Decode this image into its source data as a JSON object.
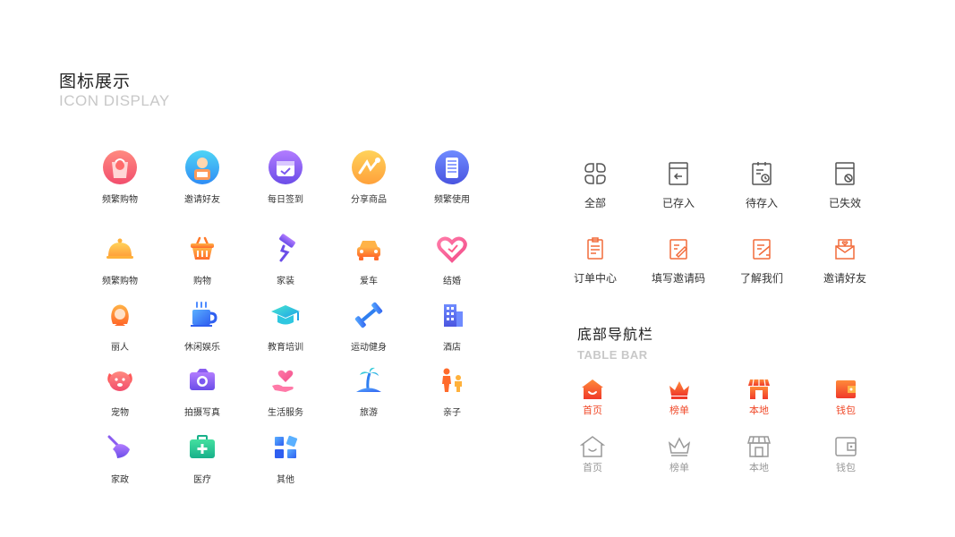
{
  "header": {
    "title_cn": "图标展示",
    "title_en": "ICON DISPLAY"
  },
  "icon_grid": [
    {
      "label": "频繁购物",
      "icon": "shopping-bag-avatar-icon"
    },
    {
      "label": "邀请好友",
      "icon": "invite-friend-avatar-icon"
    },
    {
      "label": "每日签到",
      "icon": "calendar-checkin-icon"
    },
    {
      "label": "分享商品",
      "icon": "share-product-icon"
    },
    {
      "label": "频繁使用",
      "icon": "phone-usage-icon"
    },
    {
      "label": "频繁购物",
      "icon": "food-cloche-icon"
    },
    {
      "label": "购物",
      "icon": "shopping-basket-icon"
    },
    {
      "label": "家装",
      "icon": "paint-roller-icon"
    },
    {
      "label": "爱车",
      "icon": "car-icon"
    },
    {
      "label": "结婚",
      "icon": "heart-icon"
    },
    {
      "label": "丽人",
      "icon": "beauty-woman-icon"
    },
    {
      "label": "休闲娱乐",
      "icon": "coffee-cup-icon"
    },
    {
      "label": "教育培训",
      "icon": "graduation-cap-icon"
    },
    {
      "label": "运动健身",
      "icon": "dumbbell-icon"
    },
    {
      "label": "酒店",
      "icon": "hotel-building-icon"
    },
    {
      "label": "宠物",
      "icon": "dog-face-icon"
    },
    {
      "label": "拍摄写真",
      "icon": "camera-icon"
    },
    {
      "label": "生活服务",
      "icon": "hand-heart-icon"
    },
    {
      "label": "旅游",
      "icon": "palm-beach-icon"
    },
    {
      "label": "亲子",
      "icon": "parent-child-icon"
    },
    {
      "label": "家政",
      "icon": "broom-icon"
    },
    {
      "label": "医疗",
      "icon": "medical-kit-icon"
    },
    {
      "label": "其他",
      "icon": "apps-grid-icon"
    }
  ],
  "order_icons": [
    {
      "label": "全部",
      "icon": "all-clover-icon"
    },
    {
      "label": "已存入",
      "icon": "saved-doc-icon"
    },
    {
      "label": "待存入",
      "icon": "pending-doc-icon"
    },
    {
      "label": "已失效",
      "icon": "expired-doc-icon"
    },
    {
      "label": "订单中心",
      "icon": "order-list-icon"
    },
    {
      "label": "填写邀请码",
      "icon": "fill-code-icon"
    },
    {
      "label": "了解我们",
      "icon": "about-us-icon"
    },
    {
      "label": "邀请好友",
      "icon": "invite-envelope-icon"
    }
  ],
  "tabbar": {
    "title_cn": "底部导航栏",
    "title_en": "TABLE BAR",
    "active": [
      {
        "label": "首页",
        "icon": "home-icon"
      },
      {
        "label": "榜单",
        "icon": "crown-icon"
      },
      {
        "label": "本地",
        "icon": "store-icon"
      },
      {
        "label": "钱包",
        "icon": "wallet-icon"
      }
    ],
    "inactive": [
      {
        "label": "首页",
        "icon": "home-icon"
      },
      {
        "label": "榜单",
        "icon": "crown-icon"
      },
      {
        "label": "本地",
        "icon": "store-icon"
      },
      {
        "label": "钱包",
        "icon": "wallet-icon"
      }
    ]
  },
  "colors": {
    "active_tab": "#f04a2a",
    "inactive_tab": "#999999",
    "title_en": "#c8c8c8",
    "outline_icon": "#555555",
    "orange_icon": "#f26b3a"
  }
}
